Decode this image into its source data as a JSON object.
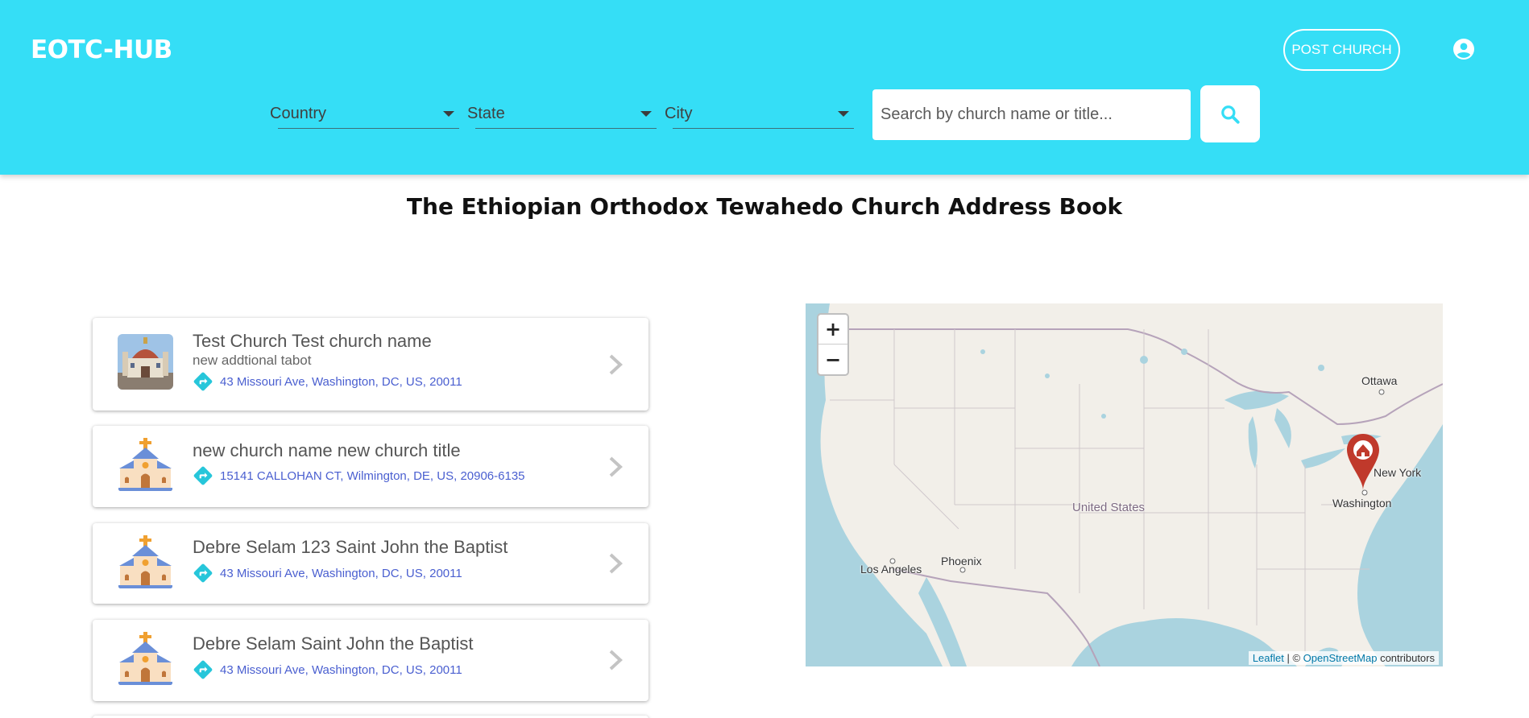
{
  "header": {
    "brand": "EOTC-HUB",
    "post_button": "POST CHURCH",
    "filters": {
      "country": "Country",
      "state": "State",
      "city": "City"
    },
    "search": {
      "placeholder": "Search by church name or title...",
      "value": ""
    }
  },
  "page": {
    "title": "The Ethiopian Orthodox Tewahedo Church Address Book"
  },
  "churches": [
    {
      "title": "Test Church Test church name",
      "subtitle": "new addtional tabot",
      "address": "43 Missouri Ave, Washington, DC, US, 20011",
      "thumbnail": "photo"
    },
    {
      "title": "new church name new church title",
      "subtitle": "",
      "address": "15141 CALLOHAN CT, Wilmington, DE, US, 20906-6135",
      "thumbnail": "church-icon"
    },
    {
      "title": "Debre Selam 123 Saint John the Baptist",
      "subtitle": "",
      "address": "43 Missouri Ave, Washington, DC, US, 20011",
      "thumbnail": "church-icon"
    },
    {
      "title": "Debre Selam Saint John the Baptist",
      "subtitle": "",
      "address": "43 Missouri Ave, Washington, DC, US, 20011",
      "thumbnail": "church-icon"
    }
  ],
  "map": {
    "zoom_in": "+",
    "zoom_out": "−",
    "labels": {
      "ottawa": "Ottawa",
      "new_york": "New York",
      "washington": "Washington",
      "united_states": "United States",
      "phoenix": "Phoenix",
      "los_angeles": "Los Angeles"
    },
    "attribution": {
      "leaflet": "Leaflet",
      "separator": " | © ",
      "osm": "OpenStreetMap",
      "suffix": " contributors"
    }
  },
  "colors": {
    "header_bg": "#35DEF6",
    "accent": "#35DEF6",
    "address_text": "#4a5fd0",
    "marker": "#c0392b",
    "direction_icon": "#26c6da"
  }
}
